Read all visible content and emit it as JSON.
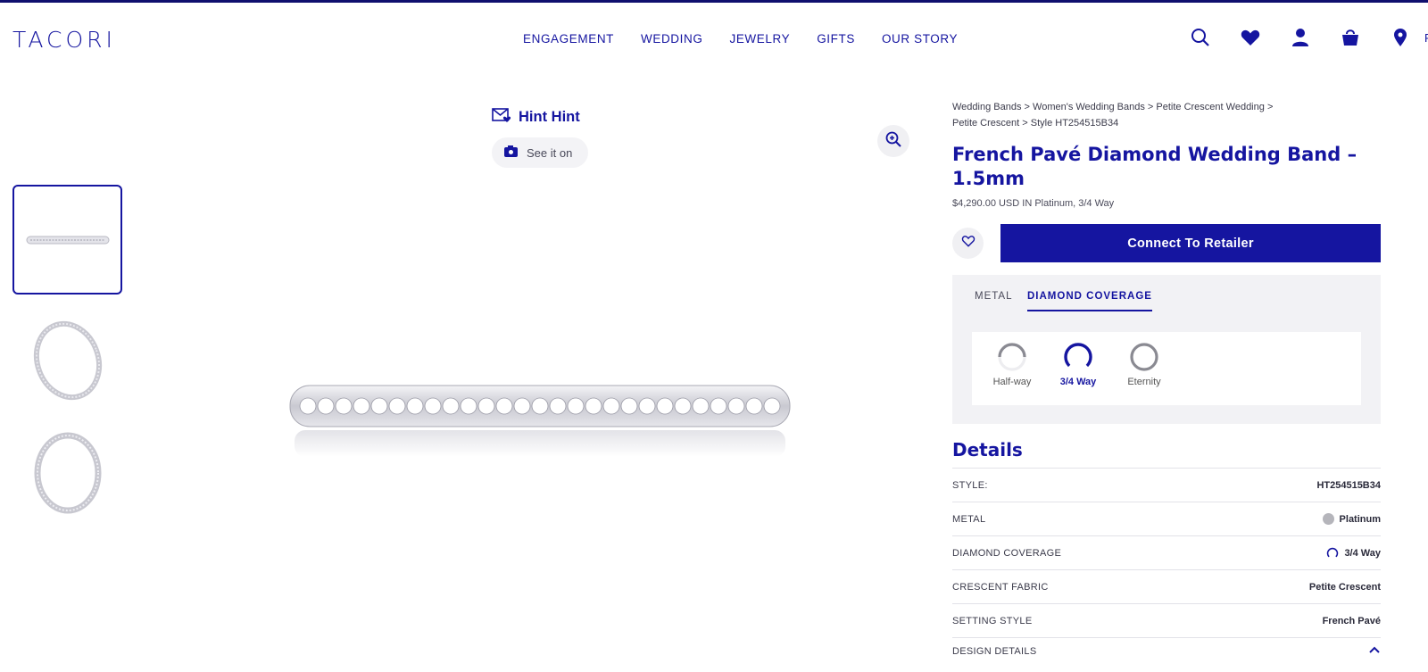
{
  "header": {
    "logo": "TACORI",
    "nav": [
      "ENGAGEMENT",
      "WEDDING",
      "JEWELRY",
      "GIFTS",
      "OUR STORY"
    ],
    "icons": [
      "search-icon",
      "heart-icon",
      "user-icon",
      "bag-icon",
      "location-icon"
    ],
    "location_partial": "F"
  },
  "media": {
    "hint_label": "Hint Hint",
    "see_it_label": "See it on"
  },
  "product": {
    "breadcrumbs": [
      "Wedding Bands",
      "Women's Wedding Bands",
      "Petite Crescent Wedding",
      "Petite Crescent",
      "Style HT254515B34"
    ],
    "title": "French Pavé Diamond Wedding Band – 1.5mm",
    "price": "$4,290.00 USD IN Platinum, 3/4 Way",
    "connect_label": "Connect To Retailer"
  },
  "options": {
    "tabs": [
      "METAL",
      "DIAMOND COVERAGE"
    ],
    "coverage": [
      {
        "label": "Half-way",
        "level": 0.5
      },
      {
        "label": "3/4 Way",
        "level": 0.75
      },
      {
        "label": "Eternity",
        "level": 1.0
      }
    ],
    "selected": "3/4 Way"
  },
  "details": {
    "heading": "Details",
    "rows": [
      {
        "label": "STYLE:",
        "value": "HT254515B34"
      },
      {
        "label": "METAL",
        "value": "Platinum"
      },
      {
        "label": "DIAMOND COVERAGE",
        "value": "3/4 Way"
      },
      {
        "label": "CRESCENT FABRIC",
        "value": "Petite Crescent"
      },
      {
        "label": "SETTING STYLE",
        "value": "French Pavé"
      },
      {
        "label": "DESIGN DETAILS",
        "value": ""
      }
    ]
  },
  "colors": {
    "brand": "#1515a0",
    "panel": "#f2f2f5",
    "platinum": "#b5b5bb"
  }
}
